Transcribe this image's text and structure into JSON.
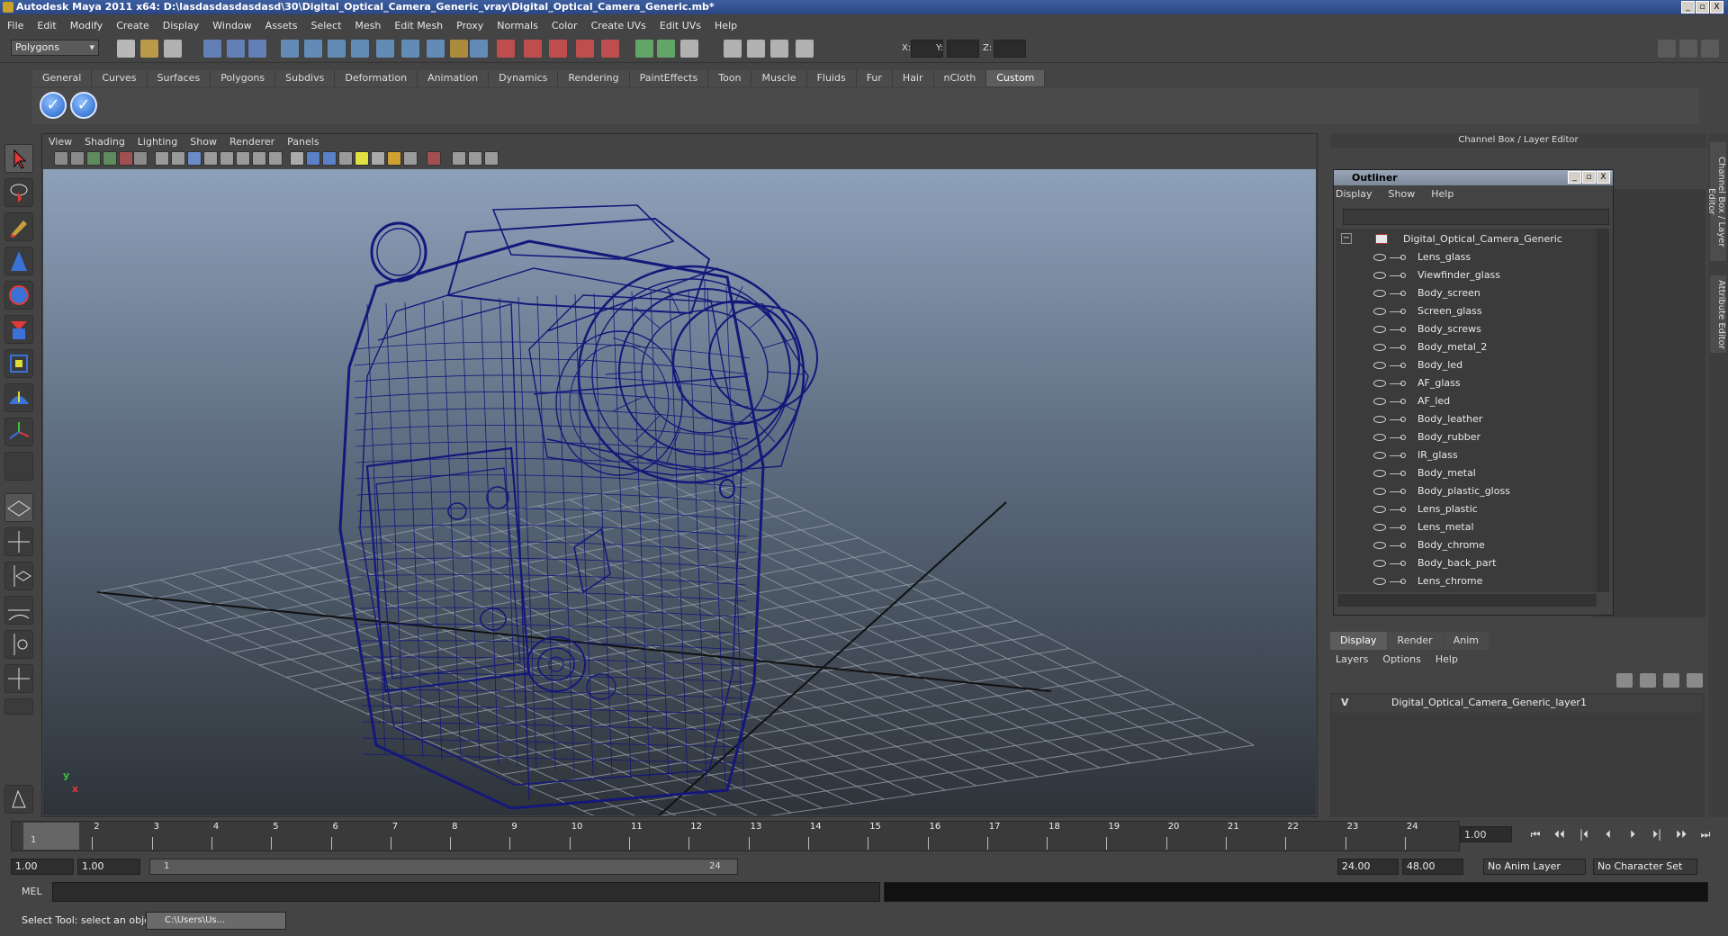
{
  "window": {
    "title": "Autodesk Maya 2011 x64: D:\\lasdasdasdasdasd\\30\\Digital_Optical_Camera_Generic_vray\\Digital_Optical_Camera_Generic.mb*",
    "min": "_",
    "max": "▫",
    "close": "X"
  },
  "menubar": [
    "File",
    "Edit",
    "Modify",
    "Create",
    "Display",
    "Window",
    "Assets",
    "Select",
    "Mesh",
    "Edit Mesh",
    "Proxy",
    "Normals",
    "Color",
    "Create UVs",
    "Edit UVs",
    "Help"
  ],
  "status": {
    "mode": "Polygons",
    "x_label": "X:",
    "y_label": "Y:",
    "z_label": "Z:"
  },
  "shelf_tabs": [
    "General",
    "Curves",
    "Surfaces",
    "Polygons",
    "Subdivs",
    "Deformation",
    "Animation",
    "Dynamics",
    "Rendering",
    "PaintEffects",
    "Toon",
    "Muscle",
    "Fluids",
    "Fur",
    "Hair",
    "nCloth",
    "Custom"
  ],
  "shelf_active": "Custom",
  "shelf_buttons": [
    "✓",
    "✓"
  ],
  "viewport": {
    "menu": [
      "View",
      "Shading",
      "Lighting",
      "Show",
      "Renderer",
      "Panels"
    ],
    "axis_y": "y",
    "axis_x": "x",
    "wire_color": "#14187a"
  },
  "channel_box": {
    "title": "Channel Box / Layer Editor"
  },
  "outliner": {
    "title": "Outliner",
    "menu": [
      "Display",
      "Show",
      "Help"
    ],
    "collapse": "−",
    "root": "Digital_Optical_Camera_Generic",
    "items": [
      "Lens_glass",
      "Viewfinder_glass",
      "Body_screen",
      "Screen_glass",
      "Body_screws",
      "Body_metal_2",
      "Body_led",
      "AF_glass",
      "AF_led",
      "Body_leather",
      "Body_rubber",
      "IR_glass",
      "Body_metal",
      "Body_plastic_gloss",
      "Lens_plastic",
      "Lens_metal",
      "Body_chrome",
      "Body_back_part",
      "Lens_chrome"
    ]
  },
  "layer_editor": {
    "tabs": [
      "Display",
      "Render",
      "Anim"
    ],
    "active": "Display",
    "menu": [
      "Layers",
      "Options",
      "Help"
    ],
    "visible": "V",
    "layer_name": "Digital_Optical_Camera_Generic_layer1"
  },
  "side_tabs": [
    "Channel Box / Layer Editor",
    "Attribute Editor"
  ],
  "timeline": {
    "ticks": [
      "1",
      "2",
      "3",
      "4",
      "5",
      "6",
      "7",
      "8",
      "9",
      "10",
      "11",
      "12",
      "13",
      "14",
      "15",
      "16",
      "17",
      "18",
      "19",
      "20",
      "21",
      "22",
      "23",
      "24"
    ],
    "current_marker": "1",
    "current": "1.00",
    "playback": [
      "⏮",
      "⏴⏴",
      "|⏴",
      "⏴",
      "⏵",
      "⏵|",
      "⏵⏵",
      "⏭"
    ]
  },
  "range": {
    "start": "1.00",
    "playback_start": "1.00",
    "slider_start": "1",
    "slider_end": "24",
    "playback_end": "24.00",
    "end": "48.00",
    "anim_layer": "No Anim Layer",
    "character_set": "No Character Set"
  },
  "mel": {
    "label": "MEL"
  },
  "help": {
    "text": "Select Tool: select an object",
    "taskbar": "C:\\Users\\Us..."
  }
}
